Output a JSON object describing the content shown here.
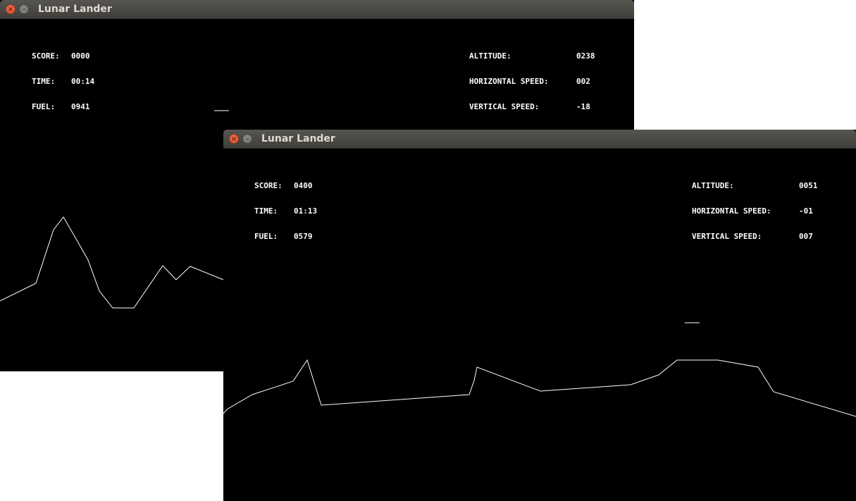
{
  "windows": [
    {
      "title": "Lunar Lander",
      "hud": {
        "score_label": "SCORE:",
        "score": "0000",
        "time_label": "TIME:",
        "time": "00:14",
        "fuel_label": "FUEL:",
        "fuel": "0941",
        "altitude_label": "ALTITUDE:",
        "altitude": "0238",
        "hspeed_label": "HORIZONTAL SPEED:",
        "hspeed": "002",
        "vspeed_label": "VERTICAL SPEED:",
        "vspeed": "-18"
      }
    },
    {
      "title": "Lunar Lander",
      "hud": {
        "score_label": "SCORE:",
        "score": "0400",
        "time_label": "TIME:",
        "time": "01:13",
        "fuel_label": "FUEL:",
        "fuel": "0579",
        "altitude_label": "ALTITUDE:",
        "altitude": "0051",
        "hspeed_label": "HORIZONTAL SPEED:",
        "hspeed": "-01",
        "vspeed_label": "VERTICAL SPEED:",
        "vspeed": "007"
      }
    }
  ],
  "colors": {
    "background": "#000000",
    "lines": "#ffffff",
    "titlebar": "#4a4945",
    "close_button": "#e5552f"
  },
  "icons": {
    "close": "close-icon",
    "minimize": "minimize-icon"
  }
}
